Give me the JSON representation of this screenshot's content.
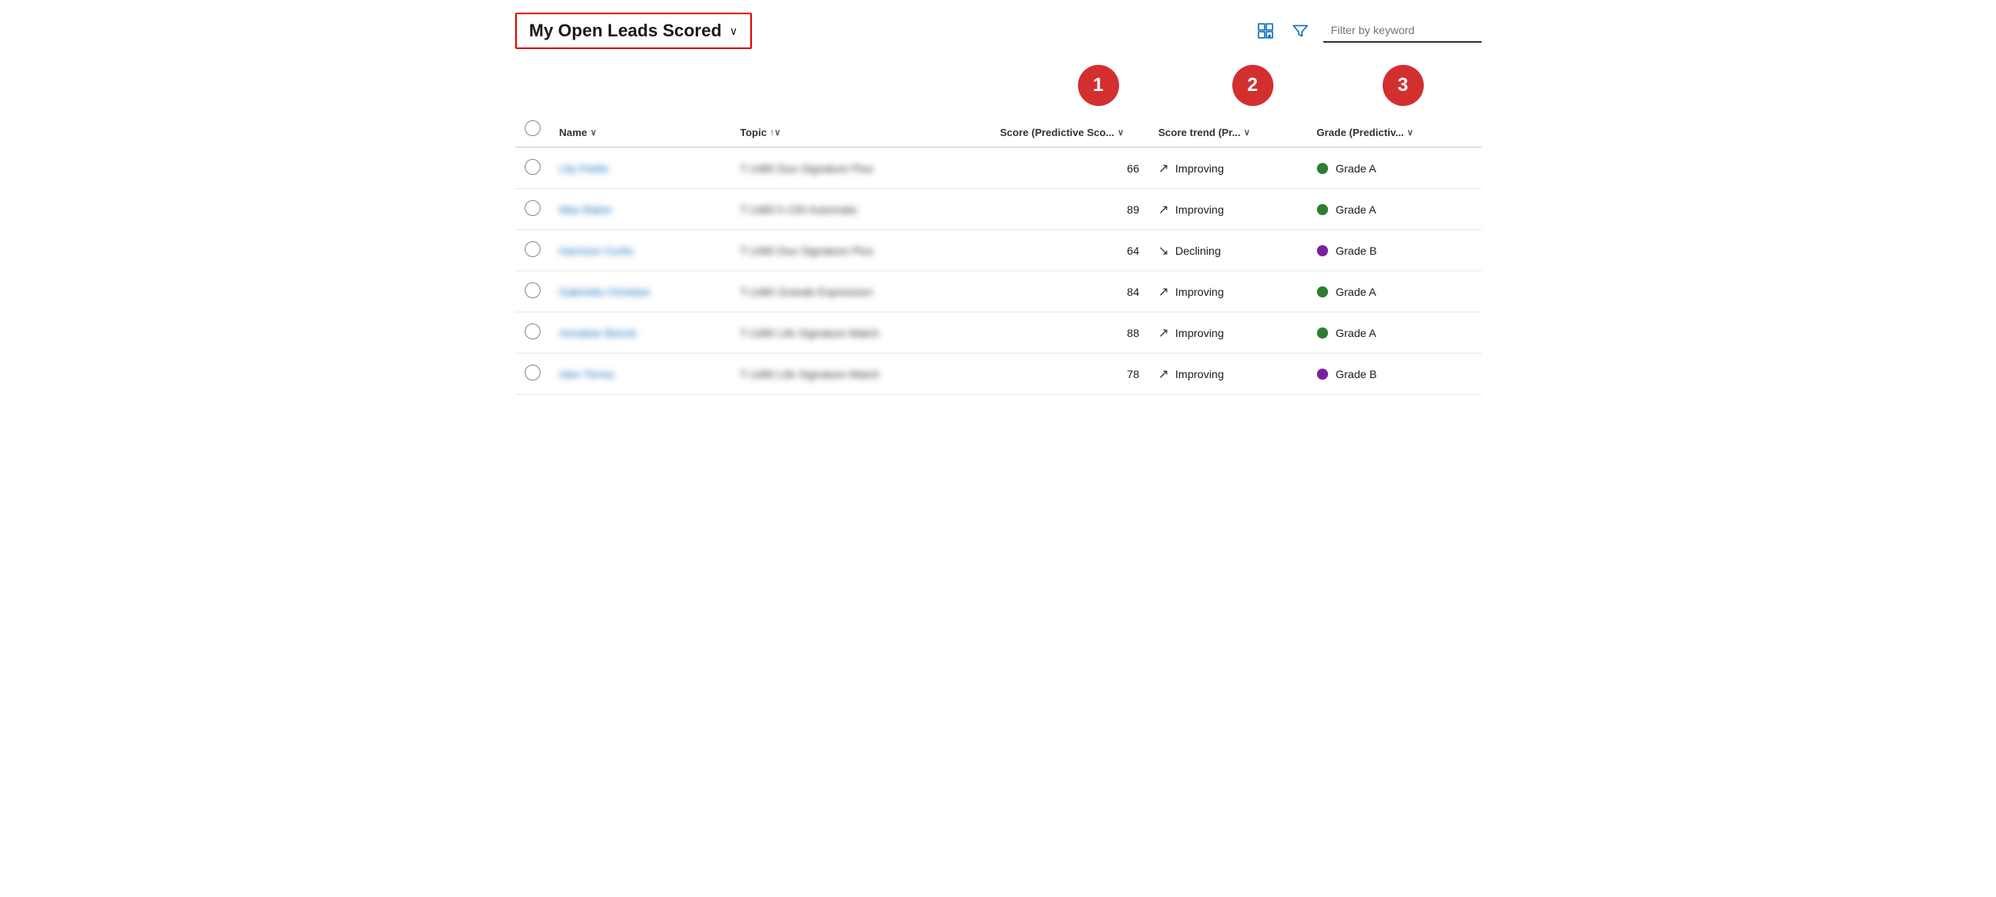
{
  "header": {
    "title": "My Open Leads Scored",
    "chevron": "∨",
    "filter_placeholder": "Filter by keyword"
  },
  "badges": [
    {
      "id": "badge-1",
      "label": "1"
    },
    {
      "id": "badge-2",
      "label": "2"
    },
    {
      "id": "badge-3",
      "label": "3"
    }
  ],
  "columns": [
    {
      "id": "checkbox",
      "label": ""
    },
    {
      "id": "name",
      "label": "Name",
      "sort": "↓"
    },
    {
      "id": "topic",
      "label": "Topic",
      "sort": "↑↓"
    },
    {
      "id": "score",
      "label": "Score (Predictive Sco...",
      "sort": "↓"
    },
    {
      "id": "trend",
      "label": "Score trend (Pr...",
      "sort": "↓"
    },
    {
      "id": "grade",
      "label": "Grade (Predictiv...",
      "sort": "↓"
    }
  ],
  "rows": [
    {
      "name": "Lily Fields",
      "topic": "T-1480 Duo Signature Plus",
      "score": 66,
      "trend_arrow": "↗",
      "trend_label": "Improving",
      "grade_color": "green",
      "grade_label": "Grade A"
    },
    {
      "name": "Max Baker",
      "topic": "T-1480 h-150 Automatic",
      "score": 89,
      "trend_arrow": "↗",
      "trend_label": "Improving",
      "grade_color": "green",
      "grade_label": "Grade A"
    },
    {
      "name": "Harrison Curtis",
      "topic": "T-1480 Duo Signature Plus",
      "score": 64,
      "trend_arrow": "↘",
      "trend_label": "Declining",
      "grade_color": "purple",
      "grade_label": "Grade B"
    },
    {
      "name": "Gabriella Christian",
      "topic": "T-1480 Grande Expression",
      "score": 84,
      "trend_arrow": "↗",
      "trend_label": "Improving",
      "grade_color": "green",
      "grade_label": "Grade A"
    },
    {
      "name": "Annalise Benoit",
      "topic": "T-1480 Life Signature Match",
      "score": 88,
      "trend_arrow": "↗",
      "trend_label": "Improving",
      "grade_color": "green",
      "grade_label": "Grade A"
    },
    {
      "name": "Alex Torres",
      "topic": "T-1480 Life Signature Match",
      "score": 78,
      "trend_arrow": "↗",
      "trend_label": "Improving",
      "grade_color": "purple",
      "grade_label": "Grade B"
    }
  ],
  "icons": {
    "view_settings": "view-settings-icon",
    "filter": "filter-icon"
  }
}
